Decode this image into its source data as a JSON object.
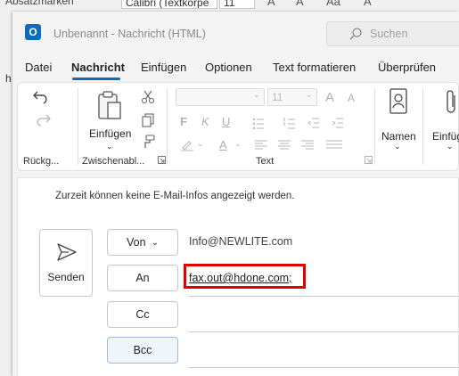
{
  "background": {
    "top_text": "Absatzmarken",
    "font_box": "Calibri (Textkörpe",
    "size_box": "11",
    "left_letter": "h",
    "glyphs": [
      "A",
      "A",
      "Aa",
      "A"
    ]
  },
  "window": {
    "app_icon": "O",
    "title": "Unbenannt  -  Nachricht (HTML)",
    "search": {
      "placeholder": "Suchen",
      "icon": "search-icon"
    }
  },
  "tabs": [
    {
      "label": "Datei"
    },
    {
      "label": "Nachricht",
      "active": true
    },
    {
      "label": "Einfügen"
    },
    {
      "label": "Optionen"
    },
    {
      "label": "Text formatieren"
    },
    {
      "label": "Überprüfen"
    }
  ],
  "ribbon": {
    "groups": {
      "undo": "Rückg...",
      "clipboard": "Zwischenabl...",
      "text": "Text"
    },
    "paste_label": "Einfügen",
    "font_size": "11",
    "names_label": "Namen",
    "attach_label": "Einfüg",
    "format_buttons": {
      "bold": "F",
      "italic": "K",
      "underline": "U",
      "grow": "A",
      "shrink": "A"
    }
  },
  "compose": {
    "info_message": "Zurzeit können keine E-Mail-Infos angezeigt werden.",
    "send_label": "Senden",
    "from_label": "Von",
    "from_value": "Info@NEWLITE.com",
    "to_label": "An",
    "to_value": "fax.out@hdone.com;",
    "cc_label": "Cc",
    "bcc_label": "Bcc"
  },
  "colors": {
    "accent": "#0f6cbd",
    "highlight": "#e00000"
  }
}
